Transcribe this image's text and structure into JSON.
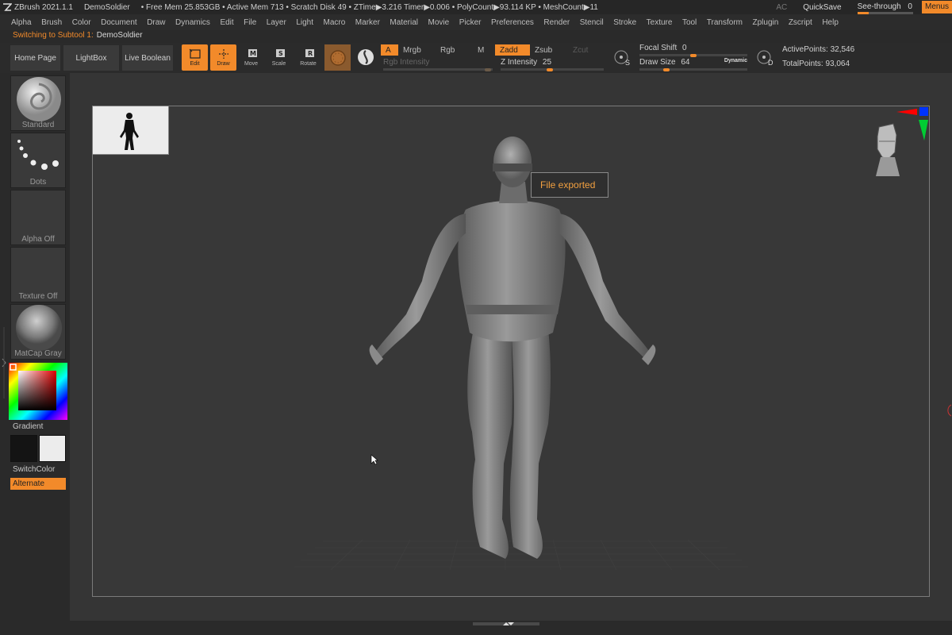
{
  "titlebar": {
    "app": "ZBrush 2021.1.1",
    "document": "DemoSoldier",
    "stats": "• Free Mem 25.853GB • Active Mem 713 • Scratch Disk 49 • ZTime▶3.216 Timer▶0.006 • PolyCount▶93.114 KP • MeshCount▶11",
    "ac": "AC",
    "quicksave": "QuickSave",
    "see_through_label": "See-through",
    "see_through_value": "0",
    "menus": "Menus"
  },
  "menubar": [
    "Alpha",
    "Brush",
    "Color",
    "Document",
    "Draw",
    "Dynamics",
    "Edit",
    "File",
    "Layer",
    "Light",
    "Macro",
    "Marker",
    "Material",
    "Movie",
    "Picker",
    "Preferences",
    "Render",
    "Stencil",
    "Stroke",
    "Texture",
    "Tool",
    "Transform",
    "Zplugin",
    "Zscript",
    "Help"
  ],
  "subtool_line": {
    "prefix": "Switching to Subtool 1:",
    "name": "DemoSoldier"
  },
  "toolbar": {
    "home_page": "Home Page",
    "lightbox": "LightBox",
    "live_boolean": "Live Boolean",
    "edit": "Edit",
    "draw": "Draw",
    "move": "Move",
    "scale": "Scale",
    "rotate": "Rotate",
    "a": "A",
    "mrgb": "Mrgb",
    "rgb": "Rgb",
    "m": "M",
    "zadd": "Zadd",
    "zsub": "Zsub",
    "zcut": "Zcut",
    "rgb_intensity": "Rgb Intensity",
    "z_intensity_label": "Z Intensity",
    "z_intensity_value": "25",
    "focal_shift_label": "Focal Shift",
    "focal_shift_value": "0",
    "draw_size_label": "Draw Size",
    "draw_size_value": "64",
    "dynamic": "Dynamic",
    "s_label": "S",
    "d_label": "D",
    "active_points": "ActivePoints: 32,546",
    "total_points": "TotalPoints: 93,064"
  },
  "shelf": {
    "brush": "Standard",
    "stroke": "Dots",
    "alpha": "Alpha Off",
    "texture": "Texture Off",
    "material": "MatCap Gray",
    "gradient": "Gradient",
    "switchcolor": "SwitchColor",
    "alternate": "Alternate"
  },
  "canvas": {
    "tooltip": "File exported"
  },
  "colors": {
    "accent": "#f28a2a",
    "background": "#2a2a2a",
    "canvas": "#383838"
  }
}
